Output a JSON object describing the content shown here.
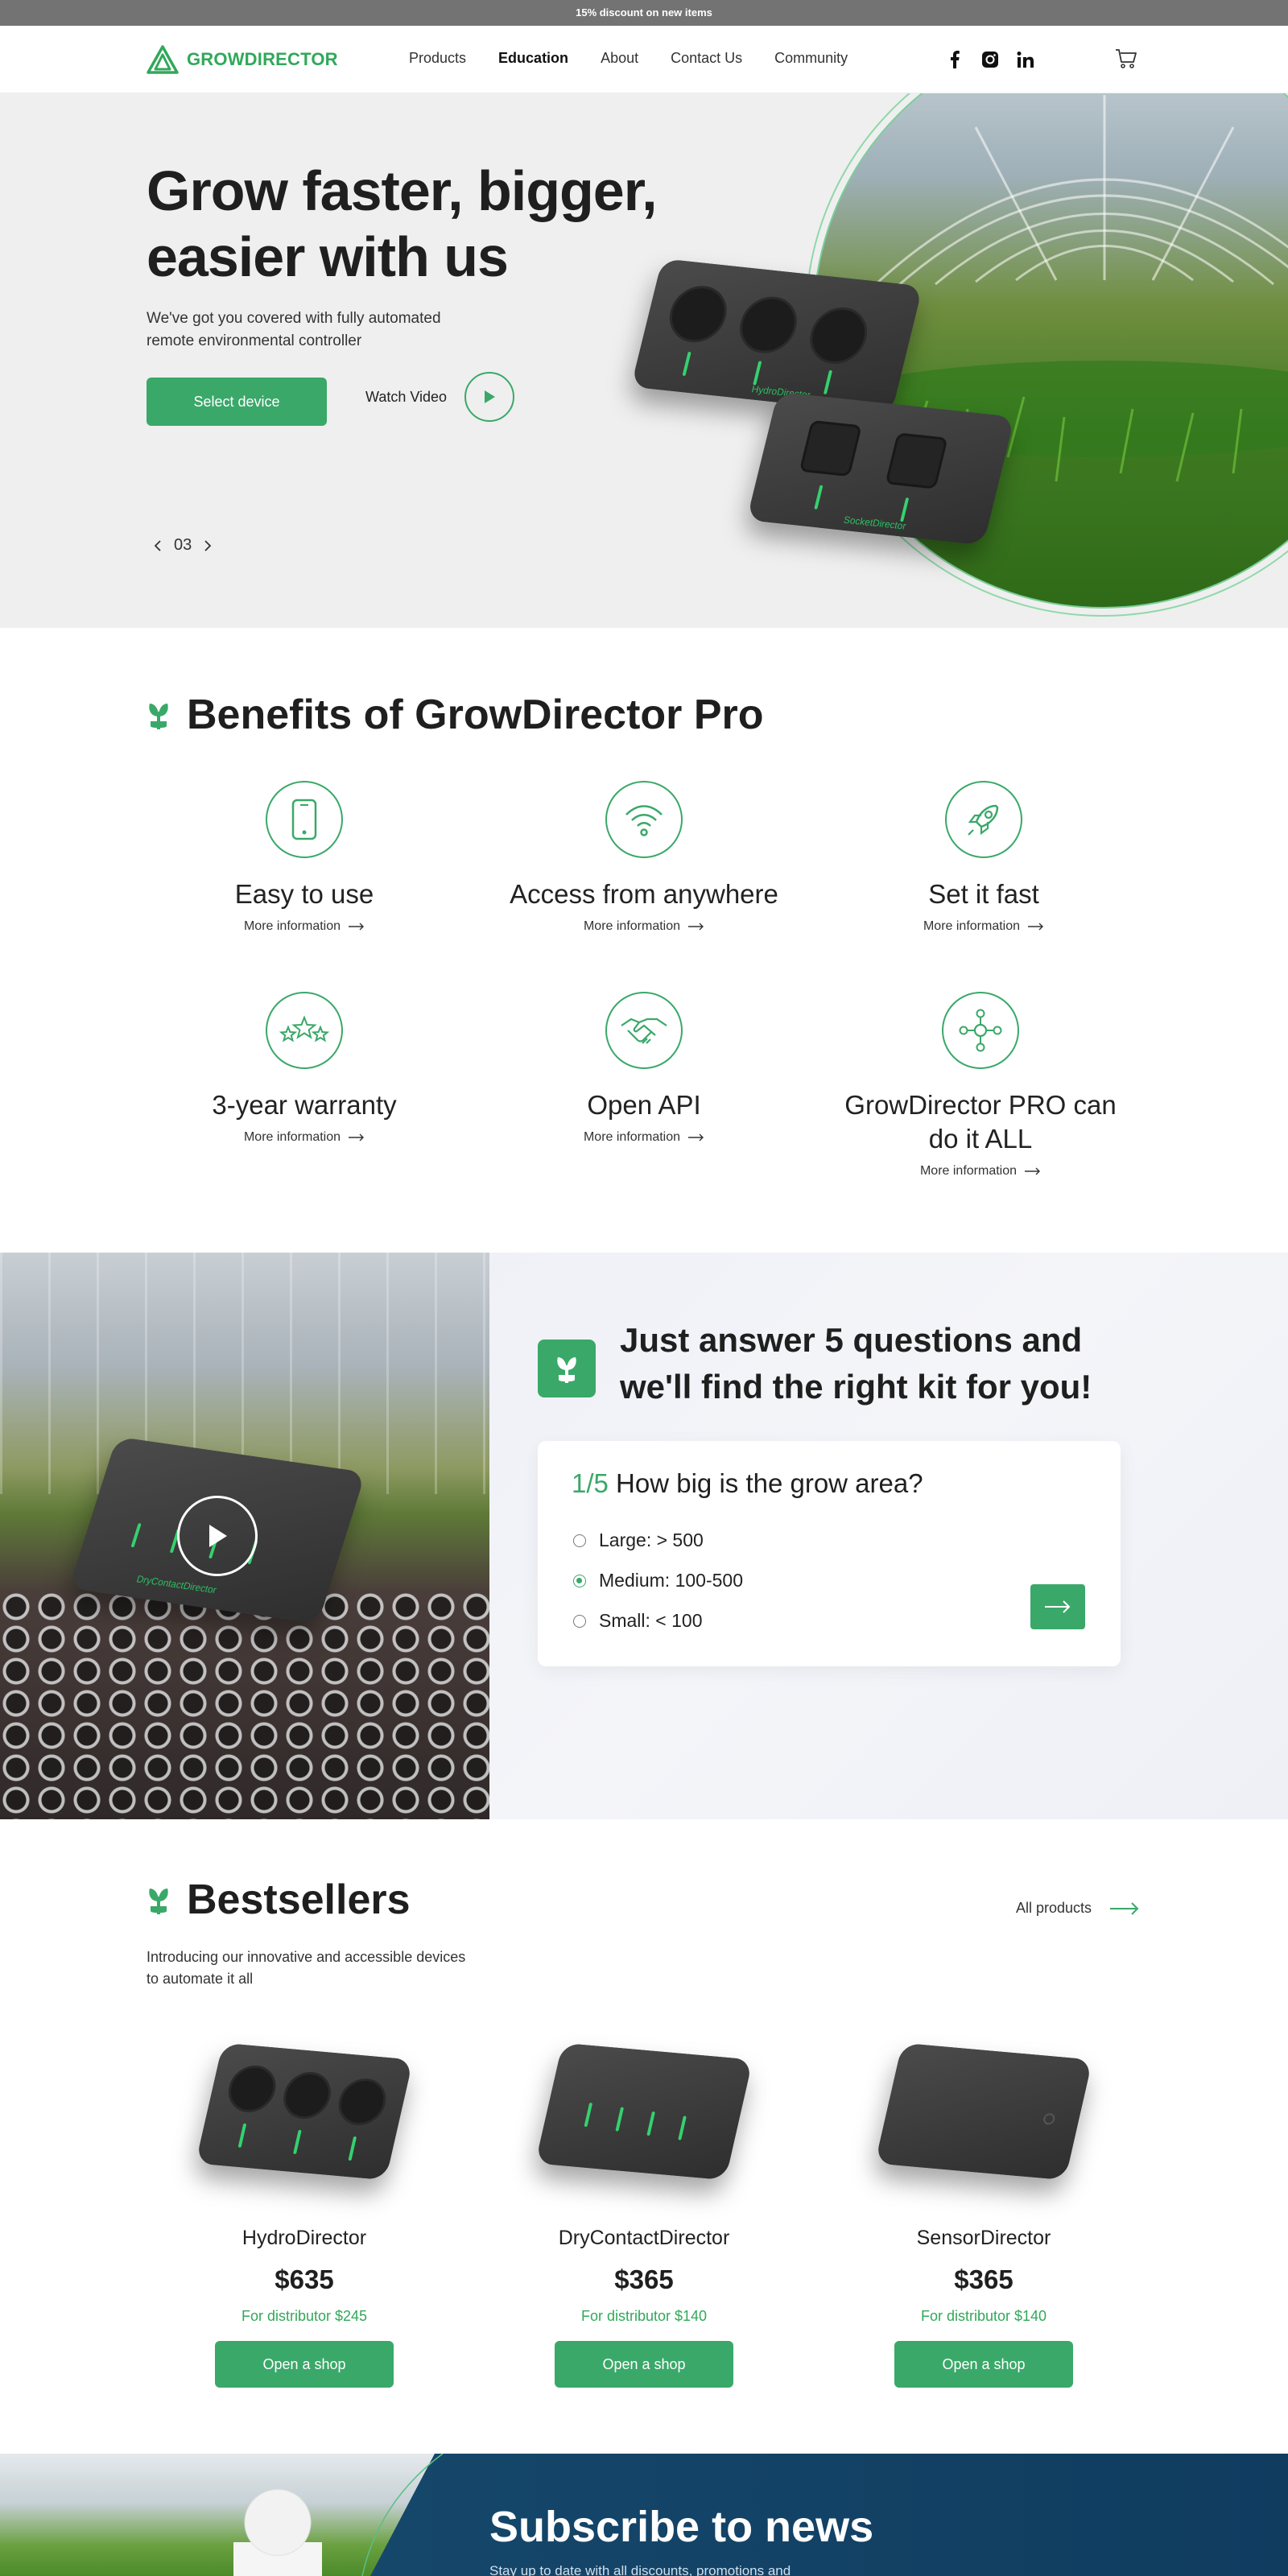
{
  "announcement": "15% discount on new items",
  "nav": {
    "brand": "GROWDIRECTOR",
    "links": [
      "Products",
      "Education",
      "About",
      "Contact Us",
      "Community"
    ],
    "active_link": "Education",
    "socials": [
      "facebook-icon",
      "instagram-icon",
      "linkedin-icon"
    ],
    "cart_icon": "cart-icon"
  },
  "hero": {
    "title": "Grow faster, bigger, easier with us",
    "subtitle": "We've got you covered with fully automated remote environmental controller",
    "cta": "Select device",
    "watch": "Watch Video",
    "slide": "03",
    "device_label_1": "HydroDirector",
    "device_label_2": "SocketDirector"
  },
  "benefits": {
    "title": "Benefits of GrowDirector Pro",
    "more": "More information",
    "items": [
      {
        "title": "Easy to use",
        "icon": "phone-icon"
      },
      {
        "title": "Access from anywhere",
        "icon": "wifi-icon"
      },
      {
        "title": "Set it fast",
        "icon": "rocket-icon"
      },
      {
        "title": "3-year warranty",
        "icon": "stars-icon"
      },
      {
        "title": "Open API",
        "icon": "handshake-icon"
      },
      {
        "title": "GrowDirector PRO can do it ALL",
        "icon": "network-icon"
      }
    ]
  },
  "quiz": {
    "title": "Just answer 5 questions and we'll find the right kit for you!",
    "step": "1/5",
    "question": "How big is the grow area?",
    "options": [
      "Large: > 500",
      "Medium: 100-500",
      "Small: < 100"
    ],
    "selected_index": 1,
    "device_label": "DryContactDirector"
  },
  "bestsellers": {
    "title": "Bestsellers",
    "subtitle": "Introducing our innovative and accessible devices to automate it all",
    "all_products": "All products",
    "shop_label": "Open a shop",
    "products": [
      {
        "name": "HydroDirector",
        "price": "$635",
        "distributor": "For distributor $245"
      },
      {
        "name": "DryContactDirector",
        "price": "$365",
        "distributor": "For distributor $140"
      },
      {
        "name": "SensorDirector",
        "price": "$365",
        "distributor": "For distributor $140"
      }
    ]
  },
  "subscribe": {
    "title": "Subscribe to news",
    "subtitle": "Stay up to date with all discounts, promotions and"
  },
  "colors": {
    "accent": "#3aa869",
    "dark_blue": "#184c70",
    "announcement_bg": "#737373"
  }
}
